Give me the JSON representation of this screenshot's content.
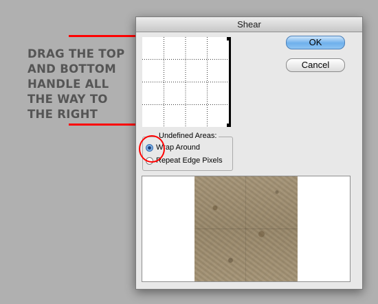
{
  "annotation": {
    "text": "DRAG THE TOP\nAND BOTTOM\nHANDLE ALL\nTHE WAY TO\nTHE RIGHT"
  },
  "dialog": {
    "title": "Shear",
    "ok_label": "OK",
    "cancel_label": "Cancel",
    "undefined_areas": {
      "title": "Undefined Areas:",
      "options": [
        {
          "label": "Wrap Around",
          "selected": true
        },
        {
          "label": "Repeat Edge Pixels",
          "selected": false
        }
      ]
    }
  },
  "colors": {
    "accent_red": "#ff0000",
    "ok_button_blue": "#6fb0ec"
  }
}
